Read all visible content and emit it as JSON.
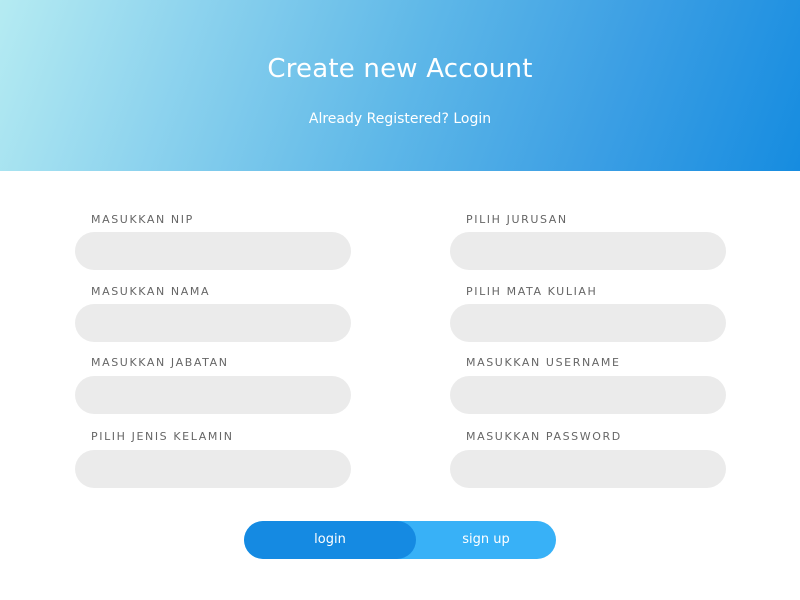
{
  "header": {
    "title": "Create new Account",
    "subtitle_prefix": "Already Registered? ",
    "login_link": "Login",
    "gradient_start": "#b5ebf2",
    "gradient_end": "#168ce0"
  },
  "form": {
    "left": [
      {
        "label": "MASUKKAN NIP",
        "value": ""
      },
      {
        "label": "MASUKKAN NAMA",
        "value": ""
      },
      {
        "label": "MASUKKAN JABATAN",
        "value": ""
      },
      {
        "label": "PILIH JENIS KELAMIN",
        "value": ""
      }
    ],
    "right": [
      {
        "label": "PILIH JURUSAN",
        "value": ""
      },
      {
        "label": "PILIH MATA KULIAH",
        "value": ""
      },
      {
        "label": "MASUKKAN USERNAME",
        "value": ""
      },
      {
        "label": "MASUKKAN PASSWORD",
        "value": ""
      }
    ]
  },
  "toggle": {
    "login_label": "login",
    "signup_label": "sign up",
    "active": "login",
    "active_color": "#158ae2",
    "inactive_color": "#38b1f7"
  }
}
